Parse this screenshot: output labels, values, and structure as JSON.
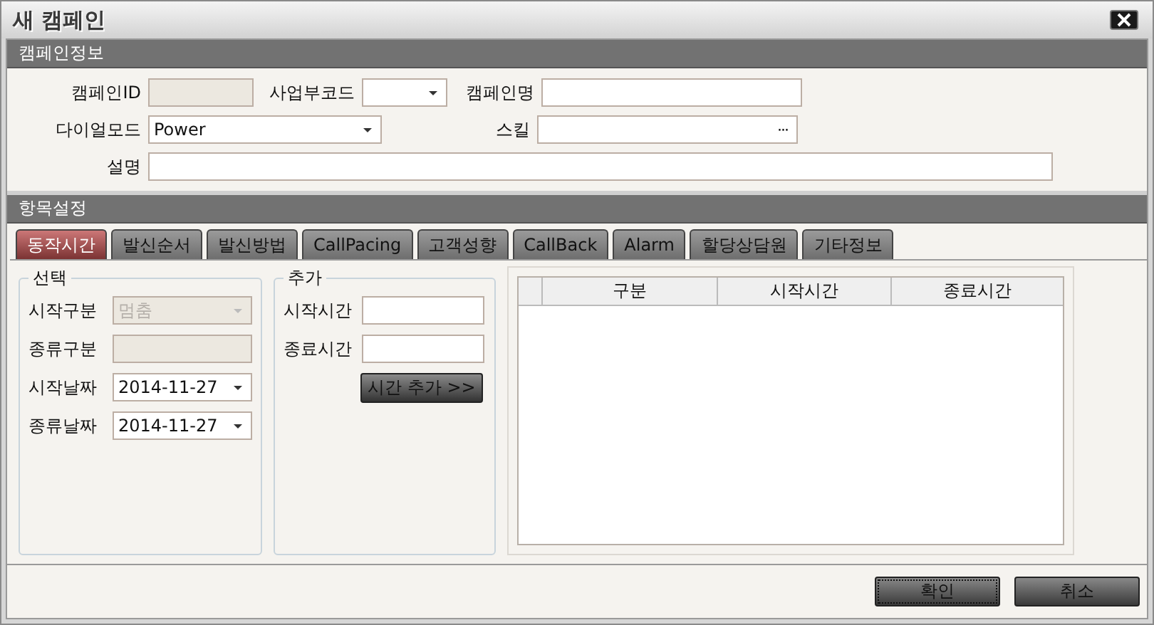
{
  "window": {
    "title": "새 캠페인"
  },
  "info": {
    "title": "캠페인정보",
    "campaign_id": {
      "label": "캠페인ID",
      "disabled": true
    },
    "business_code": {
      "label": "사업부코드"
    },
    "campaign_name": {
      "label": "캠페인명"
    },
    "dial_mode": {
      "label": "다이얼모드",
      "value": "Power"
    },
    "skill": {
      "label": "스킬",
      "button": "···"
    },
    "description": {
      "label": "설명"
    }
  },
  "settings": {
    "title": "항목설정",
    "tabs": [
      {
        "label": "동작시간",
        "selected": true
      },
      {
        "label": "발신순서",
        "selected": false
      },
      {
        "label": "발신방법",
        "selected": false
      },
      {
        "label": "CallPacing",
        "selected": false
      },
      {
        "label": "고객성향",
        "selected": false
      },
      {
        "label": "CallBack",
        "selected": false
      },
      {
        "label": "Alarm",
        "selected": false
      },
      {
        "label": "할당상담원",
        "selected": false
      },
      {
        "label": "기타정보",
        "selected": false
      }
    ],
    "select_group": {
      "title": "선택",
      "fields": [
        {
          "label": "시작구분",
          "kind": "combo",
          "value": "멈춤",
          "disabled": true
        },
        {
          "label": "종류구분",
          "kind": "text",
          "disabled": true
        },
        {
          "label": "시작날짜",
          "kind": "combo",
          "value": "2014-11-27",
          "disabled": false
        },
        {
          "label": "종류날짜",
          "kind": "combo",
          "value": "2014-11-27",
          "disabled": false
        }
      ]
    },
    "add_group": {
      "title": "추가",
      "fields": [
        {
          "label": "시작시간"
        },
        {
          "label": "종료시간"
        }
      ],
      "button": "시간 추가 >>"
    },
    "table": {
      "columns": [
        "구분",
        "시작시간",
        "종료시간"
      ]
    }
  },
  "buttons": [
    {
      "label": "확인",
      "focused": true
    },
    {
      "label": "취소",
      "focused": false
    }
  ]
}
